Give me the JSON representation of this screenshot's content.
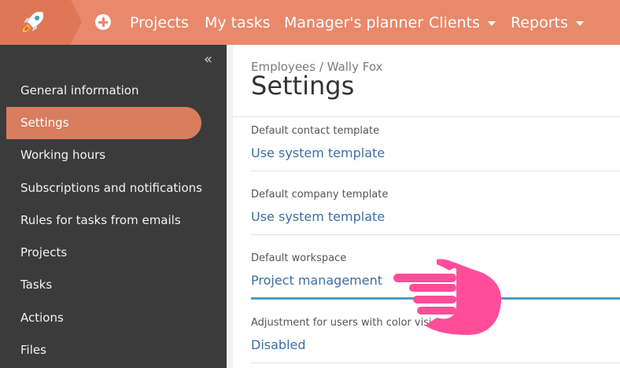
{
  "topbar": {
    "nav": [
      {
        "label": "Projects",
        "dropdown": false
      },
      {
        "label": "My tasks",
        "dropdown": false
      },
      {
        "label": "Manager's planner",
        "dropdown": false
      },
      {
        "label": "Clients",
        "dropdown": true
      },
      {
        "label": "Reports",
        "dropdown": true
      }
    ],
    "add_icon": "plus-circle-icon",
    "logo_icon": "rocket-icon"
  },
  "sidebar": {
    "collapse_icon": "double-chevron-left-icon",
    "items": [
      {
        "label": "General information",
        "active": false
      },
      {
        "label": "Settings",
        "active": true
      },
      {
        "label": "Working hours",
        "active": false
      },
      {
        "label": "Subscriptions and notifications",
        "active": false
      },
      {
        "label": "Rules for tasks from emails",
        "active": false
      },
      {
        "label": "Projects",
        "active": false
      },
      {
        "label": "Tasks",
        "active": false
      },
      {
        "label": "Actions",
        "active": false
      },
      {
        "label": "Files",
        "active": false
      }
    ]
  },
  "main": {
    "breadcrumb": "Employees / Wally Fox",
    "title": "Settings",
    "fields": [
      {
        "label": "Default contact template",
        "value": "Use system template"
      },
      {
        "label": "Default company template",
        "value": "Use system template"
      },
      {
        "label": "Default workspace",
        "value": "Project management",
        "focused": true
      },
      {
        "label": "Adjustment for users with color vision",
        "value": "Disabled"
      }
    ]
  },
  "colors": {
    "topbar": "#e8896b",
    "logo_bg": "#df7756",
    "sidebar_bg": "#3b3b3b",
    "active_item": "#d97d5f",
    "link": "#3a6ea5",
    "focus_line": "#4a9ec2",
    "pointer_hand": "#ff4d9a"
  },
  "overlay": {
    "pointer_icon": "pointing-hand-icon"
  }
}
